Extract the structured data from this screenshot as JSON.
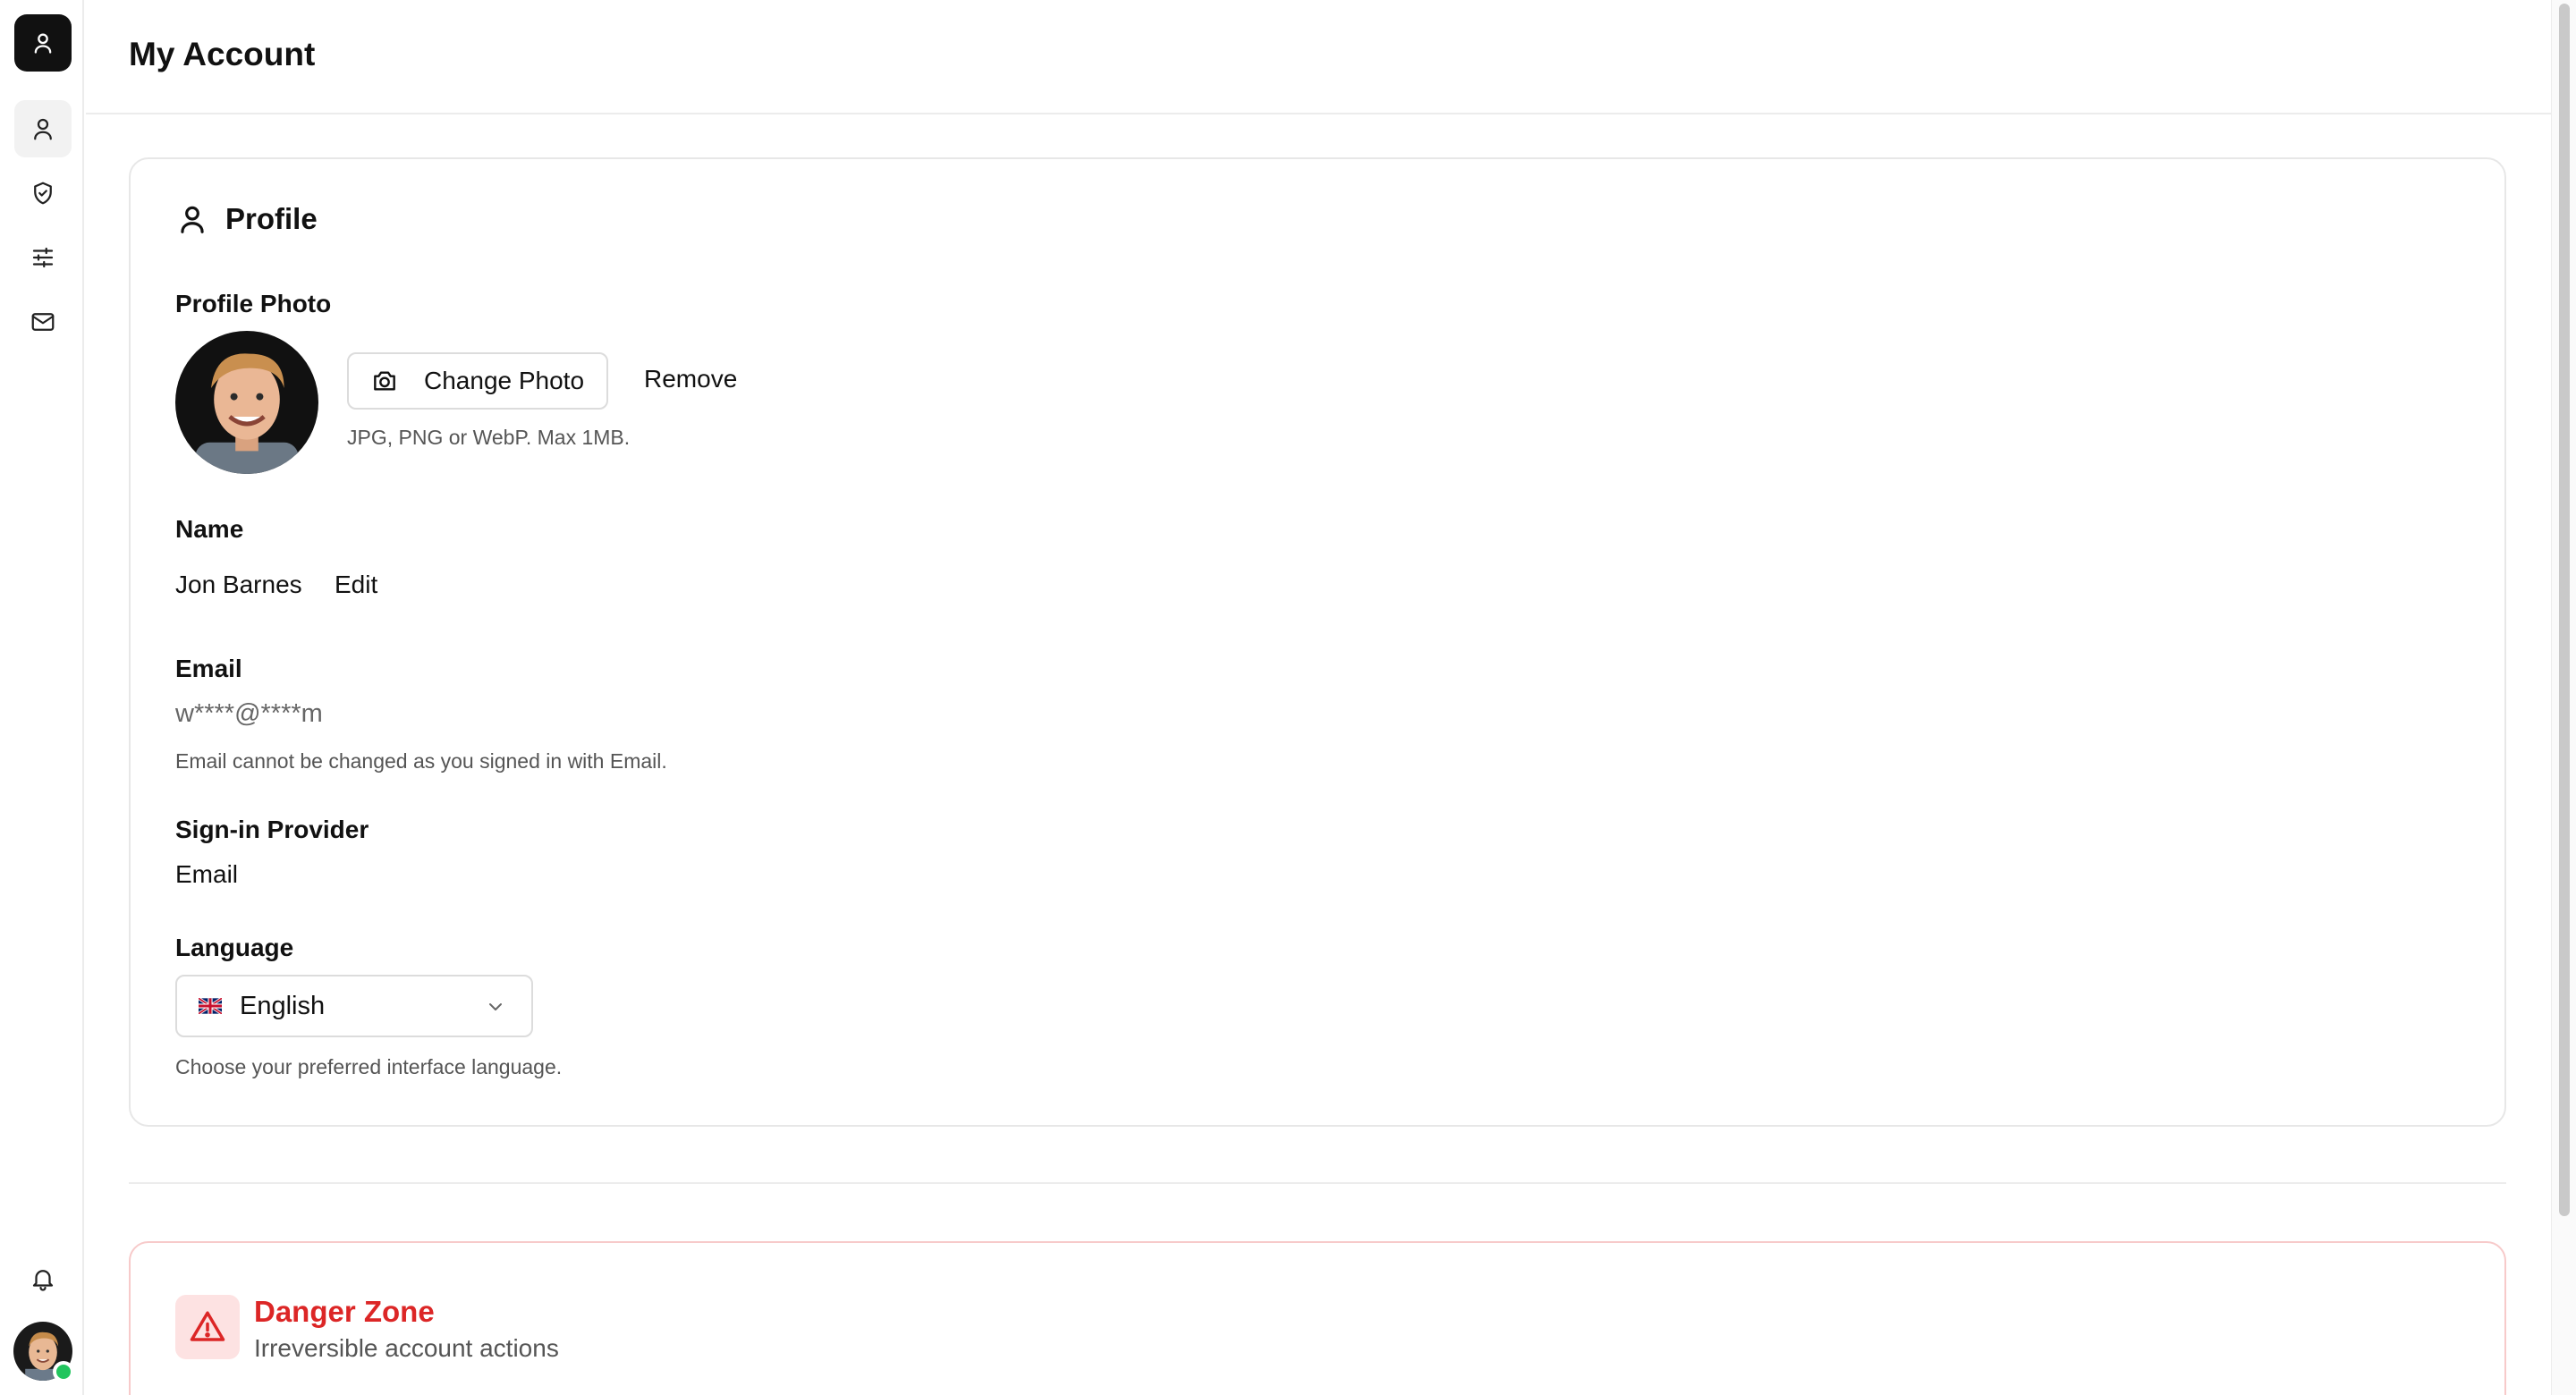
{
  "header": {
    "title": "My Account"
  },
  "sidebar": {
    "items": [
      {
        "name": "profile",
        "icon": "user-icon",
        "active": true
      },
      {
        "name": "security",
        "icon": "shield-check-icon",
        "active": false
      },
      {
        "name": "preferences",
        "icon": "sliders-icon",
        "active": false
      },
      {
        "name": "email",
        "icon": "mail-icon",
        "active": false
      }
    ],
    "bottom": {
      "notifications_icon": "bell-icon",
      "avatar_status": "online"
    }
  },
  "profile": {
    "section_title": "Profile",
    "photo": {
      "label": "Profile Photo",
      "change_label": "Change Photo",
      "remove_label": "Remove",
      "hint": "JPG, PNG or WebP. Max 1MB."
    },
    "name": {
      "label": "Name",
      "value": "Jon Barnes",
      "edit_label": "Edit"
    },
    "email": {
      "label": "Email",
      "value": "w****@****m",
      "hint": "Email cannot be changed as you signed in with Email."
    },
    "provider": {
      "label": "Sign-in Provider",
      "value": "Email"
    },
    "language": {
      "label": "Language",
      "selected": "English",
      "hint": "Choose your preferred interface language."
    }
  },
  "danger": {
    "title": "Danger Zone",
    "subtitle": "Irreversible account actions"
  },
  "colors": {
    "danger": "#dc2626",
    "danger_bg": "#fde2e2",
    "online": "#22c55e",
    "brand_bg": "#111111"
  }
}
